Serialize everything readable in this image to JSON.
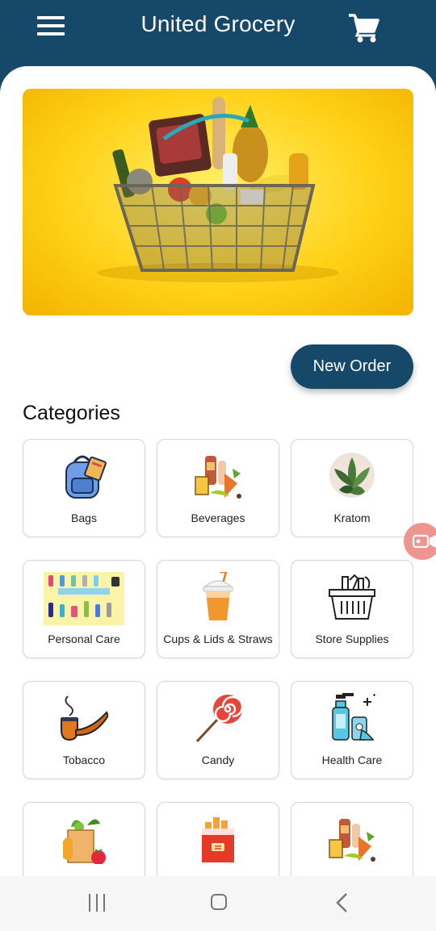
{
  "app_bar": {
    "title": "United Grocery",
    "menu_icon": "hamburger-menu-icon",
    "cart_icon": "shopping-cart-icon",
    "background": "#16486a"
  },
  "banner": {
    "image": "grocery-basket-image"
  },
  "new_order": {
    "label": "New Order"
  },
  "categories": {
    "title": "Categories",
    "items": [
      {
        "label": "Bags",
        "icon": "backpack-icon"
      },
      {
        "label": "Beverages",
        "icon": "beverages-icon"
      },
      {
        "label": "Kratom",
        "icon": "kratom-leaves-icon"
      },
      {
        "label": "Personal Care",
        "icon": "personal-care-icon"
      },
      {
        "label": "Cups & Lids & Straws",
        "icon": "cup-straw-icon"
      },
      {
        "label": "Store Supplies",
        "icon": "basket-icon"
      },
      {
        "label": "Tobacco",
        "icon": "pipe-icon"
      },
      {
        "label": "Candy",
        "icon": "lollipop-icon"
      },
      {
        "label": "Health Care",
        "icon": "health-care-icon"
      },
      {
        "label": "",
        "icon": "food-grocery-icon"
      },
      {
        "label": "",
        "icon": "cigarettes-icon"
      },
      {
        "label": "",
        "icon": "beverages-icon"
      }
    ]
  },
  "floating_button": {
    "icon": "screen-record-icon",
    "color": "#ee8a84"
  },
  "nav_bar": {
    "recents_icon": "recents-icon",
    "home_icon": "home-icon",
    "back_icon": "back-icon"
  }
}
